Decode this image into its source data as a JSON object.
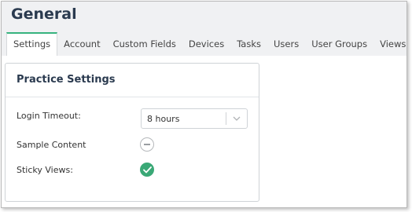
{
  "page": {
    "title": "General"
  },
  "tabs": [
    {
      "label": "Settings",
      "active": true
    },
    {
      "label": "Account"
    },
    {
      "label": "Custom Fields"
    },
    {
      "label": "Devices"
    },
    {
      "label": "Tasks"
    },
    {
      "label": "Users"
    },
    {
      "label": "User Groups"
    },
    {
      "label": "Views"
    }
  ],
  "panel": {
    "title": "Practice Settings",
    "login_timeout": {
      "label": "Login Timeout:",
      "value": "8 hours",
      "icon": "chevron-down-icon"
    },
    "sample_content": {
      "label": "Sample Content",
      "enabled": false,
      "icon": "minus-circle-icon"
    },
    "sticky_views": {
      "label": "Sticky Views:",
      "enabled": true,
      "icon": "check-circle-icon"
    }
  },
  "colors": {
    "accent": "#36b37e",
    "toggle_on": "#3aa876",
    "title": "#2a3a4f",
    "header_bg": "#f0f1f3"
  }
}
